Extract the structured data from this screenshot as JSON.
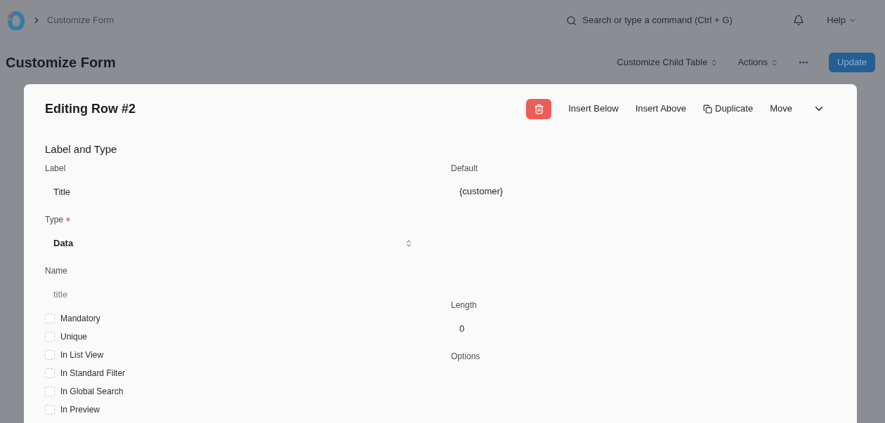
{
  "topbar": {
    "breadcrumb": "Customize Form",
    "search": {
      "placeholder": "Search or type a command (Ctrl + G)"
    },
    "help": "Help"
  },
  "page": {
    "title": "Customize Form",
    "buttons": [
      {
        "label": "Customize Child Table",
        "kind": "dropdown"
      },
      {
        "label": "Actions",
        "kind": "dropdown"
      },
      {
        "kind": "more"
      },
      {
        "label": "Update",
        "kind": "primary"
      }
    ]
  },
  "dialog": {
    "title": "Editing Row #2",
    "actions": [
      {
        "kind": "delete"
      },
      {
        "label": "Insert Below",
        "kind": "text"
      },
      {
        "label": "Insert Above",
        "kind": "text"
      },
      {
        "label": "Duplicate",
        "kind": "duplicate"
      },
      {
        "label": "Move",
        "kind": "text"
      },
      {
        "kind": "collapse"
      }
    ],
    "section": "Label and Type",
    "left_fields": [
      {
        "label": "Label",
        "value": "Title",
        "kind": "text",
        "required": false
      },
      {
        "label": "Type",
        "value": "Data",
        "kind": "select",
        "required": true
      },
      {
        "label": "Name",
        "placeholder": "title",
        "kind": "text",
        "required": false
      }
    ],
    "checkboxes": [
      {
        "label": "Mandatory",
        "checked": false
      },
      {
        "label": "Unique",
        "checked": false
      },
      {
        "label": "In List View",
        "checked": false
      },
      {
        "label": "In Standard Filter",
        "checked": false
      },
      {
        "label": "In Global Search",
        "checked": false
      },
      {
        "label": "In Preview",
        "checked": false
      }
    ],
    "right_fields": [
      {
        "label": "Default",
        "value": "{customer}",
        "kind": "textarea",
        "required": false
      },
      {
        "label": "Length",
        "value": "0",
        "kind": "text",
        "required": false
      },
      {
        "label": "Options",
        "kind": "textarea",
        "required": false
      }
    ]
  }
}
